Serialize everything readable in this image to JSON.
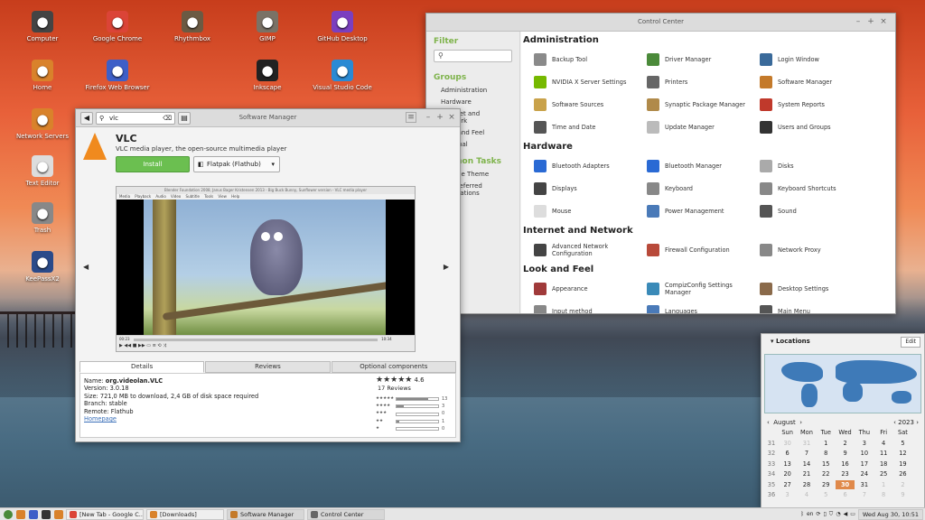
{
  "desktop": {
    "icons": [
      {
        "label": "Computer",
        "icon": "computer-icon",
        "color": "#444444"
      },
      {
        "label": "Google Chrome",
        "icon": "chrome-icon",
        "color": "#db4437"
      },
      {
        "label": "Rhythmbox",
        "icon": "rhythmbox-icon",
        "color": "#6b5a43"
      },
      {
        "label": "GIMP",
        "icon": "gimp-icon",
        "color": "#7a7266"
      },
      {
        "label": "GitHub Desktop",
        "icon": "github-icon",
        "color": "#7b3fbf"
      },
      {
        "label": "Home",
        "icon": "home-folder-icon",
        "color": "#d9822b"
      },
      {
        "label": "Firefox Web Browser",
        "icon": "firefox-icon",
        "color": "#3d5fc8"
      },
      {
        "label": "Inkscape",
        "icon": "inkscape-icon",
        "color": "#222222"
      },
      {
        "label": "Visual Studio Code",
        "icon": "vscode-icon",
        "color": "#2a8ad4"
      },
      {
        "label": "Network Servers",
        "icon": "network-folder-icon",
        "color": "#d9822b"
      },
      {
        "label": "Text Editor",
        "icon": "text-editor-icon",
        "color": "#dddddd"
      },
      {
        "label": "Trash",
        "icon": "trash-icon",
        "color": "#888888"
      },
      {
        "label": "KeePassX2",
        "icon": "keepass-icon",
        "color": "#2a4a8a"
      }
    ]
  },
  "control_center": {
    "title": "Control Center",
    "sidebar": {
      "filter_heading": "Filter",
      "search_icon": "search-icon",
      "groups_heading": "Groups",
      "groups": [
        "Administration",
        "Hardware",
        "Internet and Network",
        "Look and Feel",
        "Personal"
      ],
      "common_tasks_heading": "Common Tasks",
      "tasks": [
        "Change Theme",
        "Set Preferred Applications"
      ]
    },
    "sections": [
      {
        "title": "Administration",
        "items": [
          {
            "label": "Backup Tool",
            "color": "#8a8a8a"
          },
          {
            "label": "Driver Manager",
            "color": "#4b8a3a"
          },
          {
            "label": "Login Window",
            "color": "#3a6a9a"
          },
          {
            "label": "NVIDIA X Server Settings",
            "color": "#76b900"
          },
          {
            "label": "Printers",
            "color": "#666666"
          },
          {
            "label": "Software Manager",
            "color": "#c47a2a"
          },
          {
            "label": "Software Sources",
            "color": "#c9a24a"
          },
          {
            "label": "Synaptic Package Manager",
            "color": "#b08a4a"
          },
          {
            "label": "System Reports",
            "color": "#c0392b"
          },
          {
            "label": "Time and Date",
            "color": "#555555"
          },
          {
            "label": "Update Manager",
            "color": "#bbbbbb"
          },
          {
            "label": "Users and Groups",
            "color": "#333333"
          }
        ]
      },
      {
        "title": "Hardware",
        "items": [
          {
            "label": "Bluetooth Adapters",
            "color": "#2a6ad4"
          },
          {
            "label": "Bluetooth Manager",
            "color": "#2a6ad4"
          },
          {
            "label": "Disks",
            "color": "#aaaaaa"
          },
          {
            "label": "Displays",
            "color": "#444444"
          },
          {
            "label": "Keyboard",
            "color": "#888888"
          },
          {
            "label": "Keyboard Shortcuts",
            "color": "#888888"
          },
          {
            "label": "Mouse",
            "color": "#dddddd"
          },
          {
            "label": "Power Management",
            "color": "#4a7ab8"
          },
          {
            "label": "Sound",
            "color": "#555555"
          }
        ]
      },
      {
        "title": "Internet and Network",
        "items": [
          {
            "label": "Advanced Network Configuration",
            "color": "#444444"
          },
          {
            "label": "Firewall Configuration",
            "color": "#b84a3a"
          },
          {
            "label": "Network Proxy",
            "color": "#888888"
          }
        ]
      },
      {
        "title": "Look and Feel",
        "items": [
          {
            "label": "Appearance",
            "color": "#a03a3a"
          },
          {
            "label": "CompizConfig Settings Manager",
            "color": "#3a8ab8"
          },
          {
            "label": "Desktop Settings",
            "color": "#8a6a4a"
          },
          {
            "label": "Input method",
            "color": "#888888"
          },
          {
            "label": "Languages",
            "color": "#4a7ab8"
          },
          {
            "label": "Main Menu",
            "color": "#555555"
          }
        ]
      }
    ]
  },
  "software_manager": {
    "title": "Software Manager",
    "search_value": "vlc",
    "app_name": "VLC",
    "app_description": "VLC media player, the open-source multimedia player",
    "install_label": "Install",
    "source_label": "Flatpak (Flathub)",
    "screenshot": {
      "window_title": "Blender Foundation 2008, Janus Bager Kristensen 2013 - Big Buck Bunny, Sunflower version - VLC media player",
      "menu": "Media Playback Audio Video Subtitle Tools View Help",
      "time_start": "00:23",
      "time_end": "10:34"
    },
    "tabs": [
      "Details",
      "Reviews",
      "Optional components"
    ],
    "details": {
      "name_label": "Name:",
      "name": "org.videolan.VLC",
      "version_label": "Version:",
      "version": "3.0.18",
      "size_label": "Size:",
      "size": "721,0 MB to download, 2,4 GB of disk space required",
      "branch_label": "Branch:",
      "branch": "stable",
      "remote_label": "Remote:",
      "remote": "Flathub",
      "homepage": "Homepage"
    },
    "rating": {
      "stars": "★★★★★",
      "score": "4.6",
      "reviews": "17 Reviews",
      "breakdown": [
        {
          "stars": "★★★★★",
          "count": "13",
          "fraction": 0.76
        },
        {
          "stars": "★★★★",
          "count": "3",
          "fraction": 0.18
        },
        {
          "stars": "★★★",
          "count": "0",
          "fraction": 0
        },
        {
          "stars": "★★",
          "count": "1",
          "fraction": 0.06
        },
        {
          "stars": "★",
          "count": "0",
          "fraction": 0
        }
      ]
    }
  },
  "calendar": {
    "title": "Locations",
    "edit_label": "Edit",
    "month": "August",
    "year": "2023",
    "weekdays": [
      "Sun",
      "Mon",
      "Tue",
      "Wed",
      "Thu",
      "Fri",
      "Sat"
    ],
    "weeks": [
      {
        "wk": "31",
        "days": [
          "30",
          "31",
          "1",
          "2",
          "3",
          "4",
          "5"
        ]
      },
      {
        "wk": "32",
        "days": [
          "6",
          "7",
          "8",
          "9",
          "10",
          "11",
          "12"
        ]
      },
      {
        "wk": "33",
        "days": [
          "13",
          "14",
          "15",
          "16",
          "17",
          "18",
          "19"
        ]
      },
      {
        "wk": "34",
        "days": [
          "20",
          "21",
          "22",
          "23",
          "24",
          "25",
          "26"
        ]
      },
      {
        "wk": "35",
        "days": [
          "27",
          "28",
          "29",
          "30",
          "31",
          "1",
          "2"
        ]
      },
      {
        "wk": "36",
        "days": [
          "3",
          "4",
          "5",
          "6",
          "7",
          "8",
          "9"
        ]
      }
    ],
    "today": "30"
  },
  "taskbar": {
    "tasks": [
      {
        "label": "[New Tab - Google C...",
        "color": "#db4437"
      },
      {
        "label": "[Downloads]",
        "color": "#d9822b"
      },
      {
        "label": "Software Manager",
        "color": "#c47a2a"
      },
      {
        "label": "Control Center",
        "color": "#666666"
      }
    ],
    "keyboard_layout": "en",
    "clock": "Wed Aug 30, 10:51"
  }
}
